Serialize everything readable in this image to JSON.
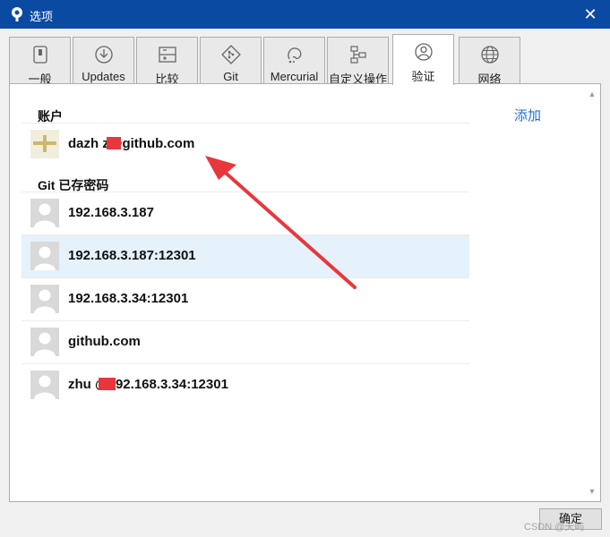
{
  "window": {
    "title": "选项",
    "close_icon": "close-icon"
  },
  "tabs": [
    {
      "label": "一般",
      "icon": "general-icon"
    },
    {
      "label": "Updates",
      "icon": "download-icon"
    },
    {
      "label": "比较",
      "icon": "compare-icon"
    },
    {
      "label": "Git",
      "icon": "git-icon"
    },
    {
      "label": "Mercurial",
      "icon": "mercurial-icon"
    },
    {
      "label": "自定义操作",
      "icon": "custom-actions-icon"
    },
    {
      "label": "验证",
      "icon": "user-icon",
      "active": true
    },
    {
      "label": "网络",
      "icon": "globe-icon"
    }
  ],
  "auth": {
    "accounts_label": "账户",
    "add_link": "添加",
    "accounts": [
      {
        "name": "dazh  z@github.com"
      }
    ],
    "git_label": "Git 已存密码",
    "git_entries": [
      {
        "host": "192.168.3.187"
      },
      {
        "host": "192.168.3.187:12301",
        "selected": true
      },
      {
        "host": "192.168.3.34:12301"
      },
      {
        "host": "github.com"
      },
      {
        "host": "zhu   @192.168.3.34:12301"
      }
    ]
  },
  "footer": {
    "ok_label": "确定",
    "watermark": "CSDN @天屿"
  },
  "colors": {
    "titlebar": "#0b4aa2",
    "selected_row": "#e5f1fb",
    "link": "#1f6fd1",
    "arrow": "#e8373c",
    "redaction": "#e8373c"
  }
}
